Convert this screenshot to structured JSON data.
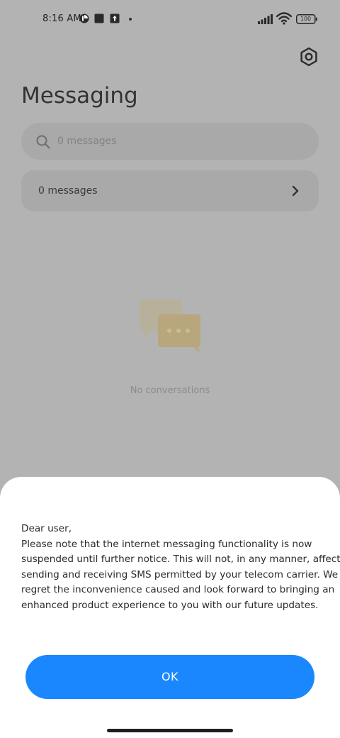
{
  "status_bar": {
    "time": "8:16 AM",
    "battery": "100",
    "icons": [
      "app-notification-icon",
      "square-notification-icon",
      "upload-icon",
      "more-dot-icon",
      "signal-icon",
      "wifi-icon",
      "battery-icon"
    ]
  },
  "header": {
    "title": "Messaging",
    "settings_icon": "settings-hexagon-icon"
  },
  "search": {
    "placeholder": "0 messages"
  },
  "summary_card": {
    "label": "0 messages"
  },
  "empty_state": {
    "text": "No conversations",
    "illustration": "chat-bubbles-icon"
  },
  "dialog": {
    "message_lines": [
      "Dear user,",
      "Please note that the internet messaging functionality is now",
      "suspended until further notice. This will not, in any manner, affect",
      "sending and receiving SMS permitted by your telecom carrier. We",
      "regret the inconvenience caused and look forward to bringing an",
      "enhanced product experience to you with our future updates."
    ],
    "ok_label": "OK"
  },
  "colors": {
    "accent": "#1a87ff",
    "overlay_background": "#b3b3b3",
    "sheet_background": "#ffffff"
  }
}
